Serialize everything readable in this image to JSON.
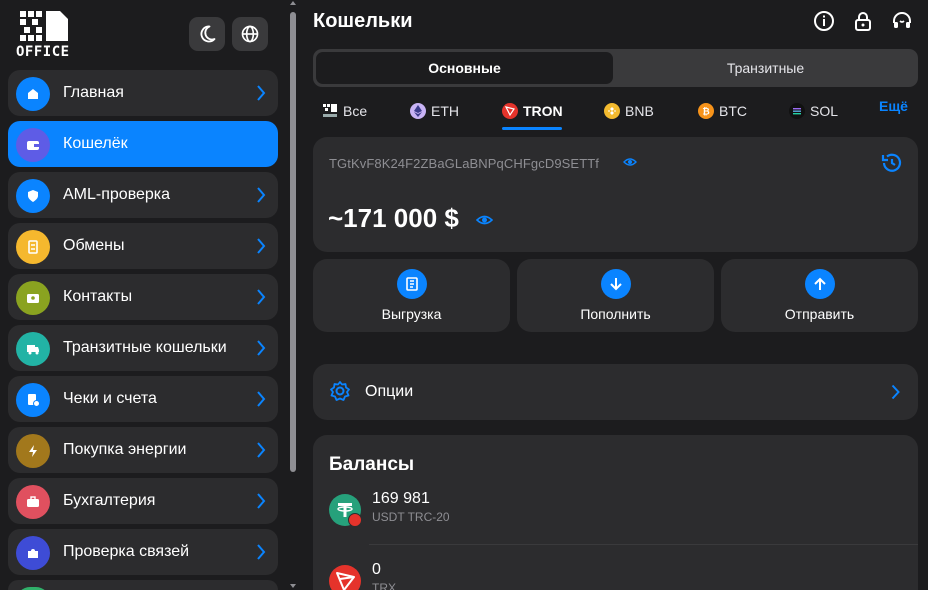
{
  "logo": {
    "word": "OFFICE"
  },
  "sidebar": {
    "items": [
      {
        "label": "Главная",
        "icon": "home-icon",
        "color": "#0a84ff",
        "active": false
      },
      {
        "label": "Кошелёк",
        "icon": "wallet-icon",
        "color": "#5e5ce6",
        "active": true
      },
      {
        "label": "AML-проверка",
        "icon": "shield-icon",
        "color": "#0a84ff",
        "active": false
      },
      {
        "label": "Обмены",
        "icon": "exchange-icon",
        "color": "#f5b82e",
        "active": false
      },
      {
        "label": "Контакты",
        "icon": "contact-card-icon",
        "color": "#8aa320",
        "active": false
      },
      {
        "label": "Транзитные кошельки",
        "icon": "truck-icon",
        "color": "#22b3a5",
        "active": false
      },
      {
        "label": "Чеки и счета",
        "icon": "invoice-icon",
        "color": "#0a84ff",
        "active": false
      },
      {
        "label": "Покупка энергии",
        "icon": "lightning-icon",
        "color": "#a2781c",
        "active": false
      },
      {
        "label": "Бухгалтерия",
        "icon": "briefcase-icon",
        "color": "#e0505f",
        "active": false
      },
      {
        "label": "Проверка связей",
        "icon": "puzzle-icon",
        "color": "#3e4cd6",
        "active": false
      }
    ]
  },
  "header": {
    "title": "Кошельки"
  },
  "tabs": {
    "main": "Основные",
    "transit": "Транзитные"
  },
  "chains": [
    {
      "label": "Все",
      "icon": "office-logo-icon",
      "active": false
    },
    {
      "label": "ETH",
      "icon": "ethereum-icon",
      "color": "#c8b3f5",
      "active": false
    },
    {
      "label": "TRON",
      "icon": "tron-icon",
      "color": "#e5332b",
      "active": true
    },
    {
      "label": "BNB",
      "icon": "bnb-icon",
      "color": "#f3ba2f",
      "active": false
    },
    {
      "label": "BTC",
      "icon": "bitcoin-icon",
      "color": "#f7931a",
      "active": false
    },
    {
      "label": "SOL",
      "icon": "solana-icon",
      "color": "#111111",
      "active": false
    }
  ],
  "chains_more": "Ещё",
  "wallet": {
    "address": "TGtKvF8K24F2ZBaGLaBNPqCHFgcD9SETTf",
    "balance": "~171 000 $"
  },
  "actions": [
    {
      "label": "Выгрузка",
      "icon": "export-file-icon"
    },
    {
      "label": "Пополнить",
      "icon": "arrow-down-icon"
    },
    {
      "label": "Отправить",
      "icon": "arrow-up-icon"
    }
  ],
  "options": {
    "label": "Опции"
  },
  "balances": {
    "title": "Балансы",
    "tokens": [
      {
        "amount": "169 981",
        "name": "USDT TRC-20",
        "icon": "usdt-icon",
        "color": "#26a17b"
      },
      {
        "amount": "0",
        "name": "TRX",
        "icon": "tron-icon",
        "color": "#e5332b"
      }
    ]
  },
  "colors": {
    "accent": "#0a84ff",
    "background": "#1c1c1e",
    "card": "#2c2c2e"
  }
}
